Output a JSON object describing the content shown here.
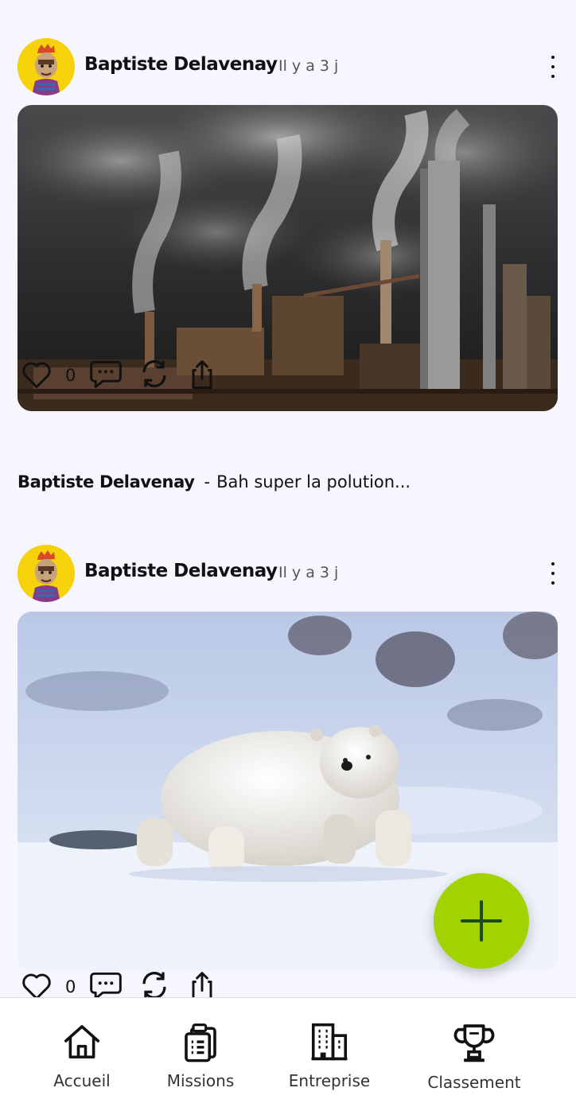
{
  "posts": [
    {
      "author": "Baptiste Delavenay",
      "time": "Il y a 3 j",
      "image": "factory-pollution-photo",
      "likes": "0",
      "caption_author": "Baptiste Delavenay",
      "caption_sep": "-",
      "caption_text": "Bah super la polution..."
    },
    {
      "author": "Baptiste Delavenay",
      "time": "Il y a 3 j",
      "image": "polar-bear-photo",
      "likes": "0"
    }
  ],
  "fab": {
    "icon": "plus-icon"
  },
  "nav": {
    "items": [
      {
        "label": "Accueil",
        "icon": "home-icon"
      },
      {
        "label": "Missions",
        "icon": "clipboard-icon"
      },
      {
        "label": "Entreprise",
        "icon": "building-icon"
      },
      {
        "label": "Classement",
        "icon": "trophy-icon"
      }
    ]
  },
  "colors": {
    "fab": "#a2d301",
    "background": "#f7f5fd",
    "avatar": "#f6d20b"
  }
}
